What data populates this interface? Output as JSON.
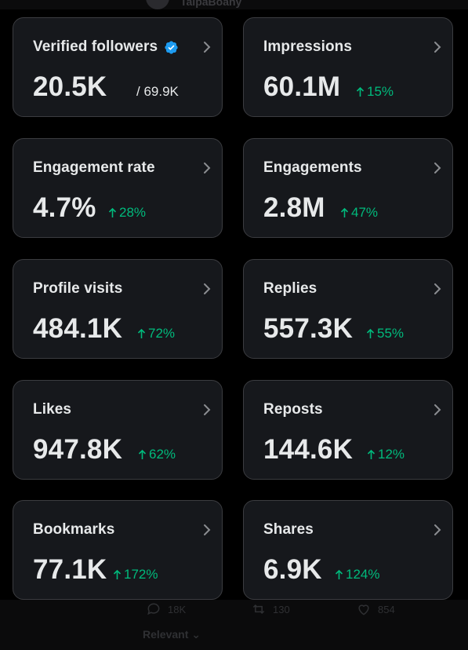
{
  "background": {
    "author_name": "TaipaBoany",
    "actions": {
      "comments": "18K",
      "reposts": "130",
      "likes": "854"
    },
    "sort_label": "Relevant"
  },
  "cards": [
    {
      "title": "Verified followers",
      "value": "20.5K",
      "extra": "/ 69.9K",
      "trend": "",
      "verified": true
    },
    {
      "title": "Impressions",
      "value": "60.1M",
      "trend": "15%"
    },
    {
      "title": "Engagement rate",
      "value": "4.7%",
      "trend": "28%"
    },
    {
      "title": "Engagements",
      "value": "2.8M",
      "trend": "47%"
    },
    {
      "title": "Profile visits",
      "value": "484.1K",
      "trend": "72%"
    },
    {
      "title": "Replies",
      "value": "557.3K",
      "trend": "55%"
    },
    {
      "title": "Likes",
      "value": "947.8K",
      "trend": "62%"
    },
    {
      "title": "Reposts",
      "value": "144.6K",
      "trend": "12%"
    },
    {
      "title": "Bookmarks",
      "value": "77.1K",
      "trend": "172%"
    },
    {
      "title": "Shares",
      "value": "6.9K",
      "trend": "124%"
    }
  ],
  "colors": {
    "card_bg": "#16181c",
    "card_border": "#3b3c40",
    "text": "#e7e9ea",
    "trend_up": "#00ba7c",
    "verified": "#1d9bf0"
  }
}
